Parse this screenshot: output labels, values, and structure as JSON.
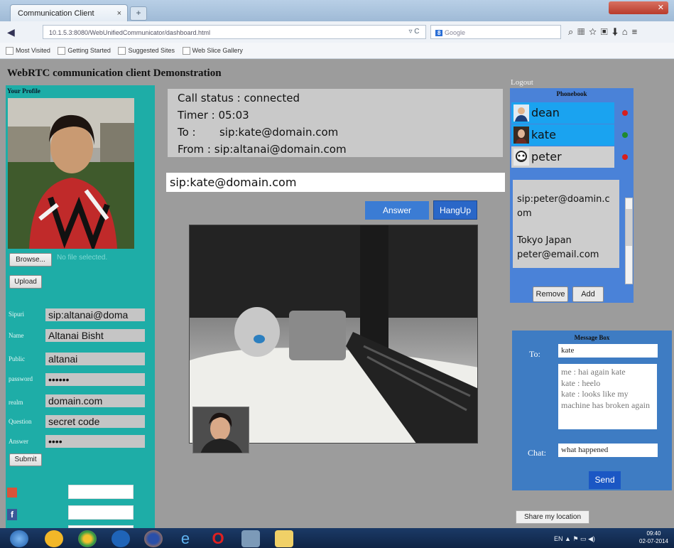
{
  "browser": {
    "tab_title": "Communication Client",
    "tab_close": "×",
    "new_tab": "+",
    "url": "10.1.5.3:8080/WebUnifiedCommunicator/dashboard.html",
    "reload_label": "▿ C",
    "search_engine_label": "Google",
    "bookmarks": [
      "Most Visited",
      "Getting Started",
      "Suggested Sites",
      "Web Slice Gallery"
    ]
  },
  "page": {
    "title": "WebRTC communication client Demonstration"
  },
  "profile": {
    "section_title": "Your Profile",
    "browse_label": "Browse...",
    "no_file_label": "No file selected.",
    "upload_label": "Upload",
    "submit_label": "Submit",
    "fields": [
      {
        "label": "Sipuri",
        "value": "sip:altanai@doma"
      },
      {
        "label": "Name",
        "value": "Altanai Bisht"
      },
      {
        "label": "Public",
        "value": "altanai"
      },
      {
        "label": "password",
        "value": "••••••"
      },
      {
        "label": "realm",
        "value": "domain.com"
      },
      {
        "label": "Question",
        "value": "secret code"
      },
      {
        "label": "Answer",
        "value": "••••"
      }
    ]
  },
  "call": {
    "status_line": "Call status : connected",
    "timer_line": "Timer : 05:03",
    "to_line": "To :       sip:kate@domain.com",
    "from_line": "From : sip:altanai@domain.com",
    "target_sip": "sip:kate@domain.com",
    "answer_label": "Answer",
    "hangup_label": "HangUp"
  },
  "phonebook": {
    "logout_label": "Logout",
    "title": "Phonebook",
    "contacts": [
      {
        "name": "dean",
        "status_color": "#d81e1e"
      },
      {
        "name": "kate",
        "status_color": "#1f8a2e"
      },
      {
        "name": "peter",
        "status_color": "#d81e1e"
      }
    ],
    "details": {
      "sip": "sip:peter@doamin.com",
      "location": "Tokyo Japan",
      "email": "peter@email.com"
    },
    "remove_label": "Remove",
    "add_label": "Add"
  },
  "messages": {
    "title": "Message Box",
    "to_label": "To:",
    "to_value": "kate",
    "log": [
      "me : hai again kate",
      "kate : heelo",
      "kate : looks like my machine has broken again"
    ],
    "chat_label": "Chat:",
    "chat_value": "what happened",
    "send_label": "Send",
    "share_label": "Share my location"
  },
  "taskbar": {
    "lang": "EN",
    "time": "09:40",
    "date": "02-07-2014"
  },
  "colors": {
    "profile_panel": "#1eada7",
    "phonebook_panel": "#4a82d8",
    "message_panel": "#3e7cc3",
    "page_background": "#9c9c9c"
  }
}
